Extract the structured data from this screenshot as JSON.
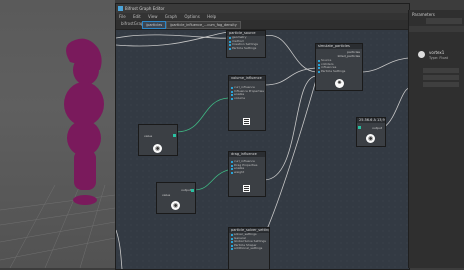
{
  "window": {
    "title": "Bifrost Graph Editor"
  },
  "menu": [
    "File",
    "Edit",
    "View",
    "Graph",
    "Options",
    "Help"
  ],
  "toolbar": {
    "breadcrumb": "bifrostGraphShape1 ▸",
    "tab_active": "/particles",
    "tab_second": "/particle_influence_...cum_fog_density"
  },
  "nodes": {
    "particle_source": {
      "title": "particle_source",
      "rows": [
        "geometry",
        "method",
        "Creation Settings",
        "Particle Settings",
        "emission_properties"
      ]
    },
    "simulate_particles": {
      "title": "simulate_particles",
      "rows": [
        "Source",
        "colliders",
        "influences",
        "Particle Settings",
        "settings"
      ],
      "output": "particles",
      "output2": "killed_particles"
    },
    "curve_influence": {
      "title": "volume_influence",
      "rows": [
        "curl_influence",
        "Influence Properties",
        "enable",
        "volume"
      ]
    },
    "value_left": {
      "title": "value",
      "row": "value",
      "output": "output"
    },
    "value_right": {
      "title": "25.56.6 A 13,987",
      "row": "output"
    },
    "drag_influence": {
      "title": "drag_influence",
      "rows": [
        "curl_influence",
        "Drag Properties",
        "enable",
        "weight"
      ]
    },
    "value_bottom": {
      "title": "value",
      "row": "value",
      "output": "output"
    },
    "particle_solver": {
      "title": "particle_solver_settings",
      "rows": [
        "solver_settings",
        "General",
        "Global Solve Settings",
        "Particle Shaper",
        "additional_settings",
        "output"
      ]
    }
  },
  "panel": {
    "title": "Parameters",
    "selected_name": "vortex1",
    "selected_type": "Type: Float"
  },
  "colors": {
    "node_bg": "#3b3f44",
    "wire": "#c7c7c7",
    "wire_green": "#3fb883",
    "accent": "#29a3d6",
    "figure": "#7a1a5c"
  }
}
